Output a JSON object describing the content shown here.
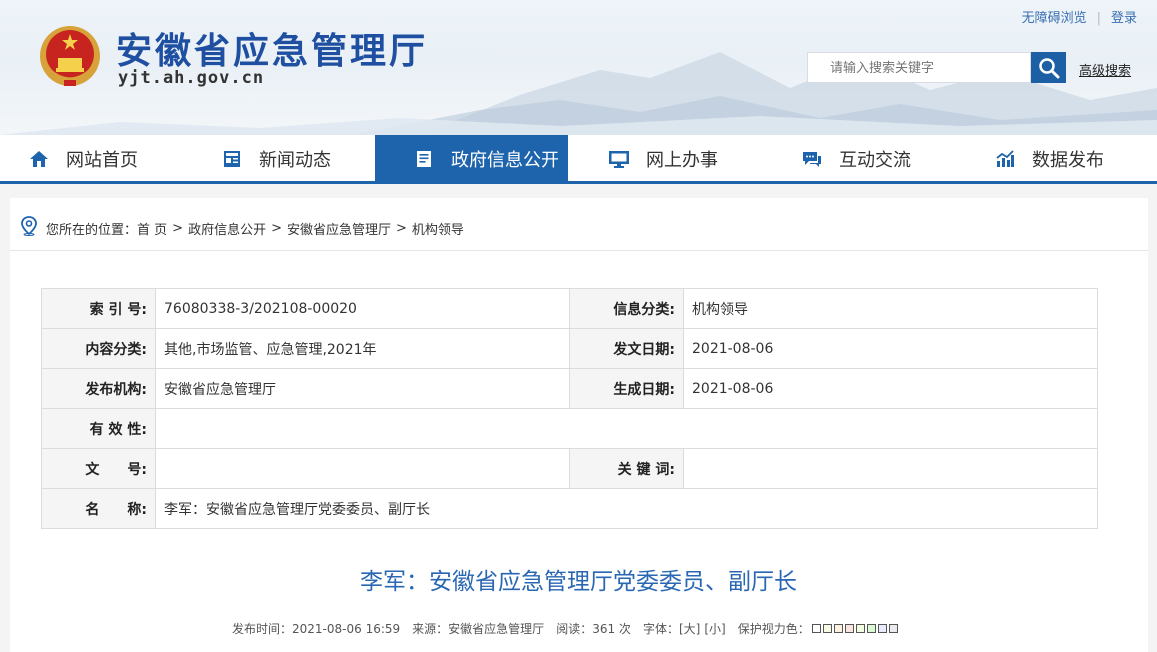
{
  "header": {
    "title": "安徽省应急管理厅",
    "domain": "yjt.ah.gov.cn",
    "accessibility_link": "无障碍浏览",
    "login_link": "登录",
    "search_placeholder": "请输入搜索关键字",
    "advanced_search": "高级搜索",
    "accent_color": "#1d64ad"
  },
  "nav": {
    "items": [
      {
        "label": "网站首页",
        "icon": "home-icon"
      },
      {
        "label": "新闻动态",
        "icon": "news-icon"
      },
      {
        "label": "政府信息公开",
        "icon": "document-icon",
        "active": true
      },
      {
        "label": "网上办事",
        "icon": "monitor-icon"
      },
      {
        "label": "互动交流",
        "icon": "chat-icon"
      },
      {
        "label": "数据发布",
        "icon": "chart-icon"
      }
    ]
  },
  "breadcrumb": {
    "prefix": "您所在的位置：",
    "items": [
      "首 页",
      "政府信息公开",
      "安徽省应急管理厅",
      "机构领导"
    ],
    "separator": ">"
  },
  "info_table": {
    "index_label": "索 引 号:",
    "index_value": "76080338-3/202108-00020",
    "category_label": "信息分类:",
    "category_value": "机构领导",
    "content_class_label": "内容分类:",
    "content_class_value": "其他,市场监管、应急管理,2021年",
    "issue_date_label": "发文日期:",
    "issue_date_value": "2021-08-06",
    "publisher_label": "发布机构:",
    "publisher_value": "安徽省应急管理厅",
    "created_date_label": "生成日期:",
    "created_date_value": "2021-08-06",
    "validity_label": "有 效 性:",
    "validity_value": "",
    "doc_no_label": "文　　号:",
    "doc_no_value": "",
    "keywords_label": "关 键 词:",
    "keywords_value": "",
    "name_label": "名　　称:",
    "name_value": "李军：安徽省应急管理厅党委委员、副厅长"
  },
  "article": {
    "title": "李军：安徽省应急管理厅党委委员、副厅长",
    "publish_time_label": "发布时间：",
    "publish_time": "2021-08-06 16:59",
    "source_label": "来源：",
    "source": "安徽省应急管理厅",
    "views_label": "阅读：",
    "views": "361 次",
    "font_label": "字体：",
    "font_large": "[大]",
    "font_small": "[小]",
    "eye_care_label": "保护视力色："
  },
  "eye_care_colors": [
    "#ffffff",
    "#fafbe6",
    "#fff2e2",
    "#fde6e0",
    "#f3ffe1",
    "#dafad4",
    "#e9ebfe",
    "#eaeaef"
  ]
}
